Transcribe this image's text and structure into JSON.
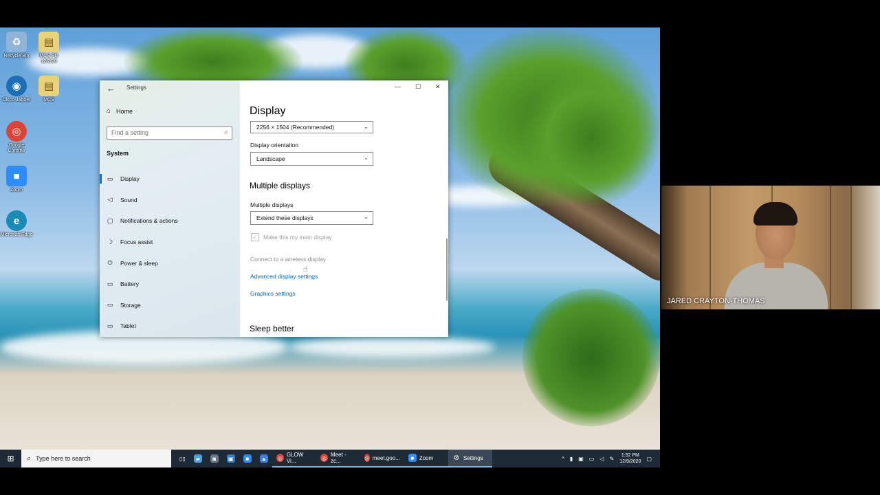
{
  "desktop": {
    "icons": [
      {
        "label": "Recycle Bin",
        "glyph": "♻",
        "color": "#8fb4d8"
      },
      {
        "label": "MCS PD 12/2/20",
        "glyph": "▤",
        "color": "#e8d27a"
      },
      {
        "label": "Cisco Jabber",
        "glyph": "◉",
        "color": "#1c6fb5"
      },
      {
        "label": "MCS",
        "glyph": "▤",
        "color": "#e8d27a"
      },
      {
        "label": "Google Chrome",
        "glyph": "◎",
        "color": "#db4437"
      },
      {
        "label": "Zoom",
        "glyph": "■",
        "color": "#2d8cff"
      },
      {
        "label": "Microsoft Edge",
        "glyph": "e",
        "color": "#1b8ab5"
      }
    ]
  },
  "settings": {
    "window_title": "Settings",
    "back_icon": "back-arrow-icon",
    "home_label": "Home",
    "search_placeholder": "Find a setting",
    "section_title": "System",
    "nav_items": [
      {
        "label": "Display",
        "icon": "monitor-icon",
        "glyph": "▭",
        "active": true
      },
      {
        "label": "Sound",
        "icon": "speaker-icon",
        "glyph": "◁"
      },
      {
        "label": "Notifications & actions",
        "icon": "notification-icon",
        "glyph": "▢"
      },
      {
        "label": "Focus assist",
        "icon": "moon-icon",
        "glyph": "☽"
      },
      {
        "label": "Power & sleep",
        "icon": "power-icon",
        "glyph": "⏻"
      },
      {
        "label": "Battery",
        "icon": "battery-icon",
        "glyph": "▭"
      },
      {
        "label": "Storage",
        "icon": "storage-icon",
        "glyph": "▭"
      },
      {
        "label": "Tablet",
        "icon": "tablet-icon",
        "glyph": "▭"
      }
    ],
    "content": {
      "title": "Display",
      "resolution_value": "2256 × 1504 (Recommended)",
      "orientation_label": "Display orientation",
      "orientation_value": "Landscape",
      "multiple_heading": "Multiple displays",
      "multiple_label": "Multiple displays",
      "multiple_value": "Extend these displays",
      "main_display_checkbox": "Make this my main display",
      "connect_wireless": "Connect to a wireless display",
      "advanced_link": "Advanced display settings",
      "graphics_link": "Graphics settings",
      "sleep_heading": "Sleep better"
    }
  },
  "taskbar": {
    "search_placeholder": "Type here to search",
    "apps": [
      {
        "label": "GLOW Vi...",
        "color": "#db4437",
        "glyph": "◎"
      },
      {
        "label": "Meet - zc...",
        "color": "#db4437",
        "glyph": "◎"
      },
      {
        "label": "meet.goo...",
        "color": "#db4437",
        "glyph": "◎"
      },
      {
        "label": "Zoom",
        "color": "#2d8cff",
        "glyph": "■"
      },
      {
        "label": "Settings",
        "color": "#555555",
        "glyph": "⚙"
      }
    ],
    "time": "1:52 PM",
    "date": "12/9/2020"
  },
  "video": {
    "participant_name": "JARED CRAYTON-THOMAS"
  }
}
